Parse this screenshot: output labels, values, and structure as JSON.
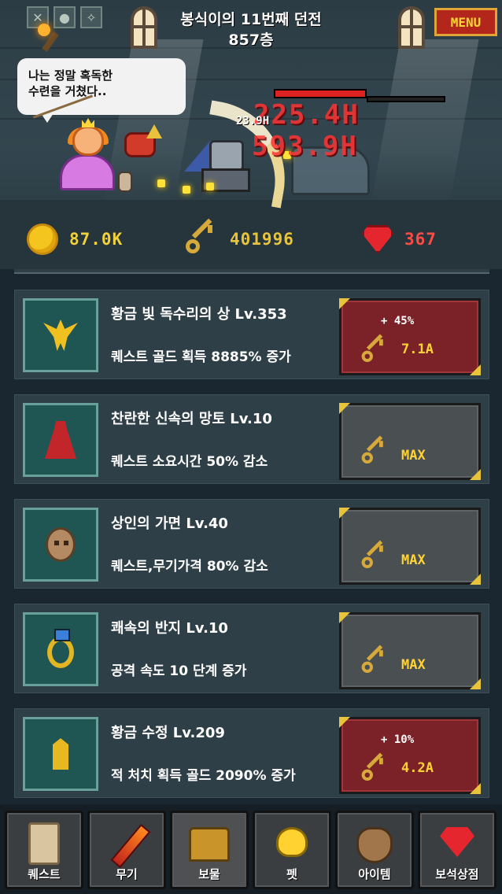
{
  "header": {
    "dungeon_title": "봉식이의 11번째 던전",
    "floor": "857층",
    "menu_label": "MENU"
  },
  "top_icons": [
    "crossed-swords-icon",
    "coin-stack-icon",
    "blessing-icon"
  ],
  "speech_bubble": {
    "line1": "나는 정말 혹독한",
    "line2": "수련을 거쳤다.."
  },
  "battle": {
    "damage_text_1": "225.4H",
    "damage_text_2": "593.9H",
    "small_damage": "23.9H",
    "enemy_hp_fraction": 1.0
  },
  "currency": {
    "gold": "87.0K",
    "keys": "401996",
    "gems": "367",
    "gold_color": "#f2d13a",
    "key_color": "#e8c43a",
    "gem_color": "#ff4b44"
  },
  "treasures": [
    {
      "icon": "golden-eagle-icon",
      "name": "황금 빛 독수리의 상 Lv.353",
      "desc": "퀘스트 골드 획득 8885% 증가",
      "pct": "+ 45%",
      "price": "7.1A",
      "state": "buy"
    },
    {
      "icon": "red-cloak-icon",
      "name": "찬란한 신속의 망토 Lv.10",
      "desc": "퀘스트 소요시간 50% 감소",
      "pct": "",
      "price": "MAX",
      "state": "max"
    },
    {
      "icon": "merchant-mask-icon",
      "name": "상인의 가면 Lv.40",
      "desc": "퀘스트,무기가격 80% 감소",
      "pct": "",
      "price": "MAX",
      "state": "max"
    },
    {
      "icon": "swift-ring-icon",
      "name": "쾌속의 반지 Lv.10",
      "desc": "공격 속도 10 단계 증가",
      "pct": "",
      "price": "MAX",
      "state": "max"
    },
    {
      "icon": "golden-crystal-icon",
      "name": "황금 수정 Lv.209",
      "desc": "적 처치 획득 골드 2090% 증가",
      "pct": "+ 10%",
      "price": "4.2A",
      "state": "buy"
    }
  ],
  "tabs": [
    {
      "label": "퀘스트",
      "icon": "scroll-icon"
    },
    {
      "label": "무기",
      "icon": "sword-icon"
    },
    {
      "label": "보물",
      "icon": "treasure-chest-icon",
      "active": true
    },
    {
      "label": "펫",
      "icon": "chick-icon"
    },
    {
      "label": "아이템",
      "icon": "bag-icon"
    },
    {
      "label": "보석상점",
      "icon": "gem-icon"
    }
  ]
}
